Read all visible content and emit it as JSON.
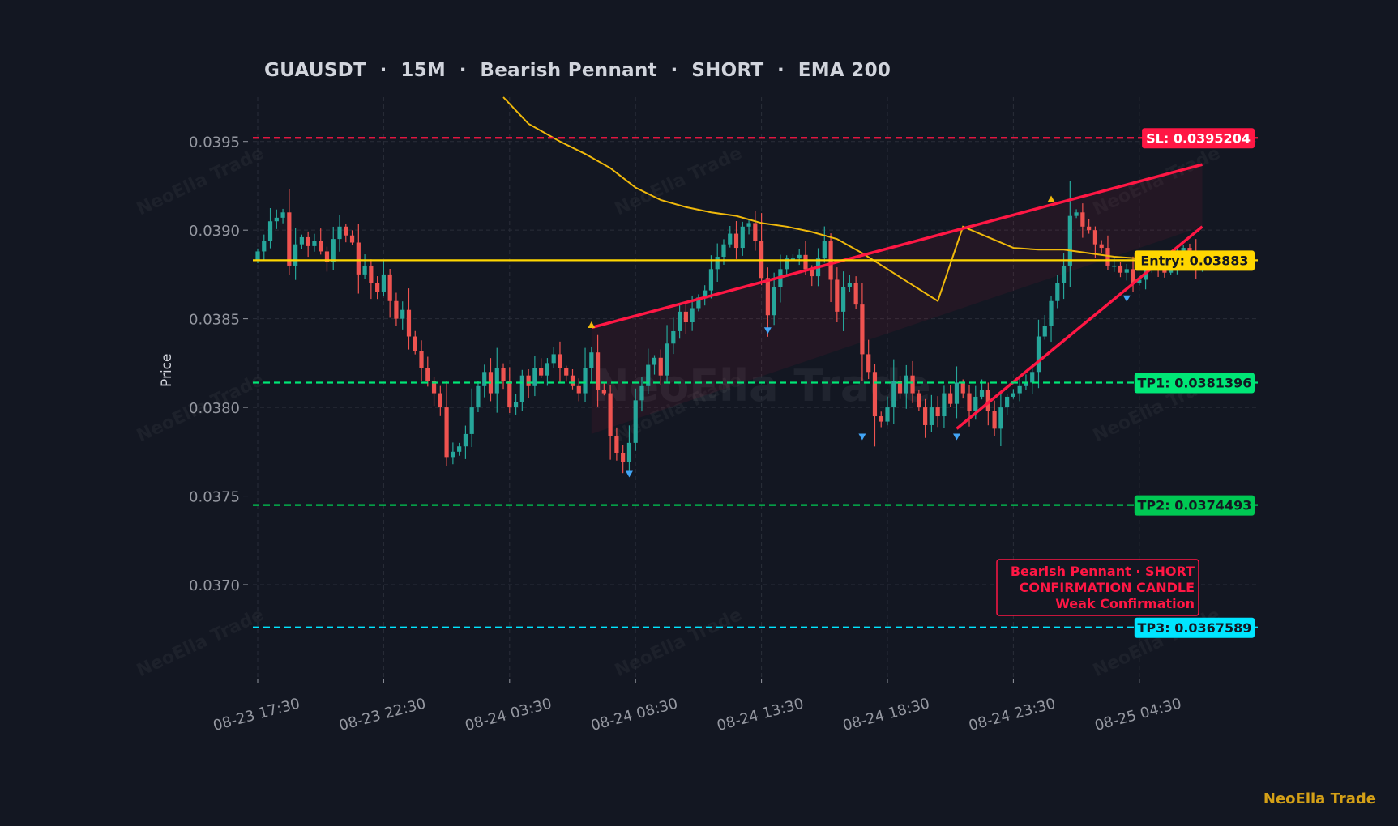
{
  "title": "GUAUSDT  ·  15M  ·  Bearish Pennant  ·  SHORT  ·  EMA 200",
  "brand": "NeoElla Trade",
  "watermark": "NeoElla Trade",
  "colors": {
    "background": "#131722",
    "grid": "#2a2e39",
    "up": "#26a69a",
    "down": "#ef5350",
    "ema": "#f0b90b",
    "entry": "#ffd600",
    "sl": "#ff1744",
    "tp1": "#00e676",
    "tp2": "#00c853",
    "tp3": "#00e5ff",
    "pattern": "#ff1744"
  },
  "chart_data": {
    "type": "candlestick",
    "ylabel": "Price",
    "xlabel": "",
    "ylim": [
      0.03647,
      0.03975
    ],
    "yticks": [
      "0.0370",
      "0.0375",
      "0.0380",
      "0.0385",
      "0.0390",
      "0.0395"
    ],
    "ytick_values": [
      0.037,
      0.0375,
      0.038,
      0.0385,
      0.039,
      0.0395
    ],
    "xticks": [
      "08-23 17:30",
      "08-23 22:30",
      "08-24 03:30",
      "08-24 08:30",
      "08-24 13:30",
      "08-24 18:30",
      "08-24 23:30",
      "08-25 04:30"
    ],
    "xtick_bars": [
      0,
      20,
      40,
      60,
      80,
      100,
      120,
      140
    ],
    "bar_count": 151,
    "candles_close": [
      0.03888,
      0.03894,
      0.03905,
      0.03907,
      0.0391,
      0.0388,
      0.03892,
      0.03896,
      0.03891,
      0.03894,
      0.03888,
      0.03882,
      0.03895,
      0.03902,
      0.03897,
      0.03893,
      0.03875,
      0.0388,
      0.0387,
      0.03865,
      0.03875,
      0.0386,
      0.0385,
      0.03855,
      0.0384,
      0.03832,
      0.03822,
      0.03815,
      0.03808,
      0.038,
      0.03772,
      0.03775,
      0.03778,
      0.03785,
      0.038,
      0.03812,
      0.0382,
      0.03808,
      0.03822,
      0.03815,
      0.038,
      0.03803,
      0.03818,
      0.03812,
      0.03822,
      0.03818,
      0.03825,
      0.0383,
      0.03822,
      0.03818,
      0.03812,
      0.03808,
      0.03822,
      0.03831,
      0.0381,
      0.03808,
      0.03784,
      0.03774,
      0.03769,
      0.0378,
      0.03804,
      0.03812,
      0.03824,
      0.03828,
      0.03818,
      0.03836,
      0.03843,
      0.03854,
      0.03848,
      0.03856,
      0.03862,
      0.03866,
      0.03878,
      0.03885,
      0.03892,
      0.03898,
      0.0389,
      0.03902,
      0.03904,
      0.03894,
      0.03873,
      0.03852,
      0.03868,
      0.03878,
      0.03884,
      0.03884,
      0.03886,
      0.03878,
      0.03874,
      0.03884,
      0.03894,
      0.03872,
      0.03854,
      0.03868,
      0.0387,
      0.03858,
      0.0383,
      0.0382,
      0.03795,
      0.03792,
      0.038,
      0.03815,
      0.03808,
      0.03818,
      0.03808,
      0.038,
      0.0379,
      0.038,
      0.03795,
      0.03808,
      0.03802,
      0.03814,
      0.03808,
      0.03798,
      0.03806,
      0.0381,
      0.03798,
      0.03788,
      0.038,
      0.03806,
      0.03808,
      0.03812,
      0.03814,
      0.0382,
      0.0384,
      0.03846,
      0.0386,
      0.0387,
      0.0388,
      0.03908,
      0.0391,
      0.03902,
      0.039,
      0.03892,
      0.0389,
      0.0388,
      0.0388,
      0.03876,
      0.03878,
      0.0387,
      0.03872,
      0.03878,
      0.0388,
      0.03878,
      0.03876,
      0.0388,
      0.03885,
      0.0389,
      0.03888,
      0.03878,
      0.03882
    ],
    "ema200": [
      [
        39,
        0.03975
      ],
      [
        43,
        0.0396
      ],
      [
        48,
        0.0395
      ],
      [
        52,
        0.03943
      ],
      [
        56,
        0.03935
      ],
      [
        60,
        0.03924
      ],
      [
        64,
        0.03917
      ],
      [
        68,
        0.03913
      ],
      [
        72,
        0.0391
      ],
      [
        76,
        0.03908
      ],
      [
        80,
        0.03904
      ],
      [
        84,
        0.03902
      ],
      [
        88,
        0.03899
      ],
      [
        92,
        0.03895
      ],
      [
        96,
        0.03887
      ],
      [
        100,
        0.03878
      ],
      [
        104,
        0.03869
      ],
      [
        108,
        0.0386
      ],
      [
        112,
        0.03902
      ],
      [
        116,
        0.03896
      ],
      [
        120,
        0.0389
      ],
      [
        124,
        0.03889
      ],
      [
        128,
        0.03889
      ],
      [
        132,
        0.03887
      ],
      [
        136,
        0.03885
      ],
      [
        140,
        0.03884
      ],
      [
        144,
        0.03883
      ],
      [
        150,
        0.03883
      ]
    ],
    "levels": [
      {
        "label": "SL: 0.0395204",
        "value": 0.0395204,
        "style": "dashed",
        "color": "#ff1744",
        "text_color": "#ffffff"
      },
      {
        "label": "Entry: 0.03883",
        "value": 0.03883,
        "style": "solid",
        "color": "#ffd600",
        "text_color": "#131722"
      },
      {
        "label": "TP1: 0.0381396",
        "value": 0.0381396,
        "style": "dashed",
        "color": "#00e676",
        "text_color": "#131722"
      },
      {
        "label": "TP2: 0.0374493",
        "value": 0.0374493,
        "style": "dashed",
        "color": "#00c853",
        "text_color": "#131722"
      },
      {
        "label": "TP3: 0.0367589",
        "value": 0.0367589,
        "style": "dashed",
        "color": "#00e5ff",
        "text_color": "#131722"
      }
    ],
    "pennant_upper": [
      [
        53,
        0.03845
      ],
      [
        150,
        0.03937
      ]
    ],
    "pennant_lower": [
      [
        111,
        0.03788
      ],
      [
        150,
        0.03902
      ]
    ],
    "flag_zone": [
      [
        53,
        0.03845
      ],
      [
        150,
        0.03937
      ],
      [
        150,
        0.03902
      ],
      [
        53,
        0.03785
      ]
    ],
    "pivots_high": [
      [
        53,
        0.03843
      ],
      [
        126,
        0.03914
      ]
    ],
    "pivots_low": [
      [
        59,
        0.03766
      ],
      [
        81,
        0.03847
      ],
      [
        96,
        0.03787
      ],
      [
        111,
        0.03787
      ],
      [
        138,
        0.03865
      ]
    ],
    "annotation": [
      "Bearish Pennant · SHORT",
      "CONFIRMATION CANDLE",
      "Weak Confirmation"
    ]
  }
}
